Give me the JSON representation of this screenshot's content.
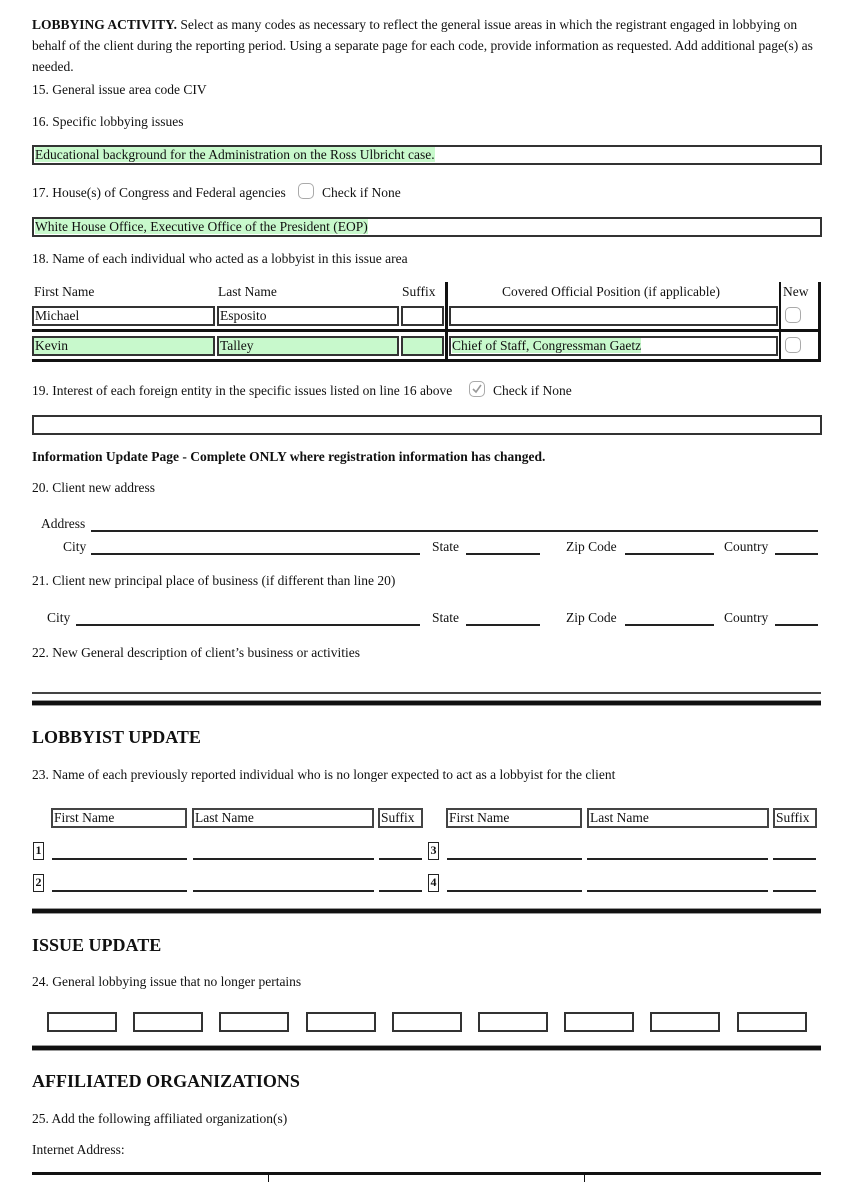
{
  "intro": {
    "heading": "LOBBYING ACTIVITY.",
    "body": " Select as many codes as necessary to reflect the general issue areas in which the registrant engaged in lobbying on behalf of the client during the reporting period. Using a separate page for each code, provide information as requested. Add additional page(s) as needed."
  },
  "line15": {
    "label": "15. General issue area code CIV"
  },
  "line16": {
    "label": "16. Specific lobbying issues",
    "value": "Educational background for the Administration on the Ross Ulbricht case."
  },
  "line17": {
    "label": "17. House(s) of Congress and Federal agencies",
    "check_label": "Check if None",
    "checked": false,
    "value": "White House Office, Executive Office of the President (EOP)"
  },
  "line18": {
    "label": "18. Name of each individual who acted as a lobbyist in this issue area",
    "columns": [
      "First Name",
      "Last Name",
      "Suffix",
      "Covered Official Position (if applicable)",
      "New"
    ],
    "rows": [
      {
        "first": "Michael",
        "last": "Esposito",
        "suffix": "",
        "position": "",
        "new": false
      },
      {
        "first": "Kevin",
        "last": "Talley",
        "suffix": "",
        "position": "Chief of Staff, Congressman Gaetz",
        "new": false
      }
    ]
  },
  "line19": {
    "label": "19. Interest of each foreign entity in the specific issues listed on line 16 above",
    "check_label": "Check if None",
    "checked": true,
    "value": ""
  },
  "info_update": {
    "heading": "Information Update Page - Complete ONLY where registration information has changed."
  },
  "line20": {
    "label": "20. Client new address",
    "address_label": "Address",
    "city_label": "City",
    "state_label": "State",
    "zip_label": "Zip Code",
    "country_label": "Country"
  },
  "line21": {
    "label": "21. Client new principal place of business (if different than line 20)",
    "city_label": "City",
    "state_label": "State",
    "zip_label": "Zip Code",
    "country_label": "Country"
  },
  "line22": {
    "label": "22. New General description of client’s business or activities"
  },
  "lobbyist_update": {
    "heading": "LOBBYIST UPDATE",
    "line23": "23. Name of each previously reported individual who is no longer expected to act as a lobbyist for the client",
    "columns": [
      "First Name",
      "Last Name",
      "Suffix"
    ],
    "numbers": [
      "1",
      "2",
      "3",
      "4"
    ]
  },
  "issue_update": {
    "heading": "ISSUE UPDATE",
    "line24": "24. General lobbying issue that no longer pertains",
    "boxes": [
      "",
      "",
      "",
      "",
      "",
      "",
      "",
      "",
      ""
    ]
  },
  "affiliated": {
    "heading": "AFFILIATED ORGANIZATIONS",
    "line25": "25. Add the following affiliated organization(s)",
    "internet_label": "Internet Address:"
  }
}
